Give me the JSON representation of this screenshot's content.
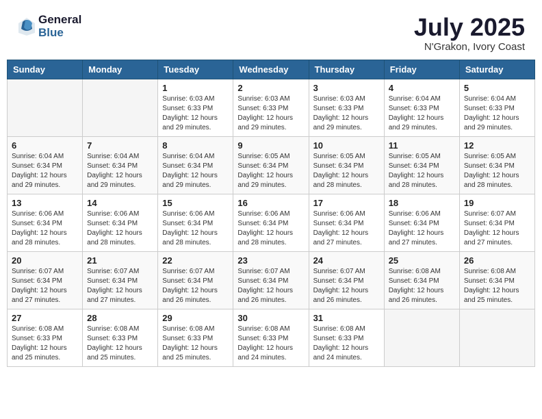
{
  "header": {
    "logo_general": "General",
    "logo_blue": "Blue",
    "month_year": "July 2025",
    "location": "N'Grakon, Ivory Coast"
  },
  "days_of_week": [
    "Sunday",
    "Monday",
    "Tuesday",
    "Wednesday",
    "Thursday",
    "Friday",
    "Saturday"
  ],
  "weeks": [
    [
      {
        "day": "",
        "sunrise": "",
        "sunset": "",
        "daylight": ""
      },
      {
        "day": "",
        "sunrise": "",
        "sunset": "",
        "daylight": ""
      },
      {
        "day": "1",
        "sunrise": "Sunrise: 6:03 AM",
        "sunset": "Sunset: 6:33 PM",
        "daylight": "Daylight: 12 hours and 29 minutes."
      },
      {
        "day": "2",
        "sunrise": "Sunrise: 6:03 AM",
        "sunset": "Sunset: 6:33 PM",
        "daylight": "Daylight: 12 hours and 29 minutes."
      },
      {
        "day": "3",
        "sunrise": "Sunrise: 6:03 AM",
        "sunset": "Sunset: 6:33 PM",
        "daylight": "Daylight: 12 hours and 29 minutes."
      },
      {
        "day": "4",
        "sunrise": "Sunrise: 6:04 AM",
        "sunset": "Sunset: 6:33 PM",
        "daylight": "Daylight: 12 hours and 29 minutes."
      },
      {
        "day": "5",
        "sunrise": "Sunrise: 6:04 AM",
        "sunset": "Sunset: 6:33 PM",
        "daylight": "Daylight: 12 hours and 29 minutes."
      }
    ],
    [
      {
        "day": "6",
        "sunrise": "Sunrise: 6:04 AM",
        "sunset": "Sunset: 6:34 PM",
        "daylight": "Daylight: 12 hours and 29 minutes."
      },
      {
        "day": "7",
        "sunrise": "Sunrise: 6:04 AM",
        "sunset": "Sunset: 6:34 PM",
        "daylight": "Daylight: 12 hours and 29 minutes."
      },
      {
        "day": "8",
        "sunrise": "Sunrise: 6:04 AM",
        "sunset": "Sunset: 6:34 PM",
        "daylight": "Daylight: 12 hours and 29 minutes."
      },
      {
        "day": "9",
        "sunrise": "Sunrise: 6:05 AM",
        "sunset": "Sunset: 6:34 PM",
        "daylight": "Daylight: 12 hours and 29 minutes."
      },
      {
        "day": "10",
        "sunrise": "Sunrise: 6:05 AM",
        "sunset": "Sunset: 6:34 PM",
        "daylight": "Daylight: 12 hours and 28 minutes."
      },
      {
        "day": "11",
        "sunrise": "Sunrise: 6:05 AM",
        "sunset": "Sunset: 6:34 PM",
        "daylight": "Daylight: 12 hours and 28 minutes."
      },
      {
        "day": "12",
        "sunrise": "Sunrise: 6:05 AM",
        "sunset": "Sunset: 6:34 PM",
        "daylight": "Daylight: 12 hours and 28 minutes."
      }
    ],
    [
      {
        "day": "13",
        "sunrise": "Sunrise: 6:06 AM",
        "sunset": "Sunset: 6:34 PM",
        "daylight": "Daylight: 12 hours and 28 minutes."
      },
      {
        "day": "14",
        "sunrise": "Sunrise: 6:06 AM",
        "sunset": "Sunset: 6:34 PM",
        "daylight": "Daylight: 12 hours and 28 minutes."
      },
      {
        "day": "15",
        "sunrise": "Sunrise: 6:06 AM",
        "sunset": "Sunset: 6:34 PM",
        "daylight": "Daylight: 12 hours and 28 minutes."
      },
      {
        "day": "16",
        "sunrise": "Sunrise: 6:06 AM",
        "sunset": "Sunset: 6:34 PM",
        "daylight": "Daylight: 12 hours and 28 minutes."
      },
      {
        "day": "17",
        "sunrise": "Sunrise: 6:06 AM",
        "sunset": "Sunset: 6:34 PM",
        "daylight": "Daylight: 12 hours and 27 minutes."
      },
      {
        "day": "18",
        "sunrise": "Sunrise: 6:06 AM",
        "sunset": "Sunset: 6:34 PM",
        "daylight": "Daylight: 12 hours and 27 minutes."
      },
      {
        "day": "19",
        "sunrise": "Sunrise: 6:07 AM",
        "sunset": "Sunset: 6:34 PM",
        "daylight": "Daylight: 12 hours and 27 minutes."
      }
    ],
    [
      {
        "day": "20",
        "sunrise": "Sunrise: 6:07 AM",
        "sunset": "Sunset: 6:34 PM",
        "daylight": "Daylight: 12 hours and 27 minutes."
      },
      {
        "day": "21",
        "sunrise": "Sunrise: 6:07 AM",
        "sunset": "Sunset: 6:34 PM",
        "daylight": "Daylight: 12 hours and 27 minutes."
      },
      {
        "day": "22",
        "sunrise": "Sunrise: 6:07 AM",
        "sunset": "Sunset: 6:34 PM",
        "daylight": "Daylight: 12 hours and 26 minutes."
      },
      {
        "day": "23",
        "sunrise": "Sunrise: 6:07 AM",
        "sunset": "Sunset: 6:34 PM",
        "daylight": "Daylight: 12 hours and 26 minutes."
      },
      {
        "day": "24",
        "sunrise": "Sunrise: 6:07 AM",
        "sunset": "Sunset: 6:34 PM",
        "daylight": "Daylight: 12 hours and 26 minutes."
      },
      {
        "day": "25",
        "sunrise": "Sunrise: 6:08 AM",
        "sunset": "Sunset: 6:34 PM",
        "daylight": "Daylight: 12 hours and 26 minutes."
      },
      {
        "day": "26",
        "sunrise": "Sunrise: 6:08 AM",
        "sunset": "Sunset: 6:34 PM",
        "daylight": "Daylight: 12 hours and 25 minutes."
      }
    ],
    [
      {
        "day": "27",
        "sunrise": "Sunrise: 6:08 AM",
        "sunset": "Sunset: 6:33 PM",
        "daylight": "Daylight: 12 hours and 25 minutes."
      },
      {
        "day": "28",
        "sunrise": "Sunrise: 6:08 AM",
        "sunset": "Sunset: 6:33 PM",
        "daylight": "Daylight: 12 hours and 25 minutes."
      },
      {
        "day": "29",
        "sunrise": "Sunrise: 6:08 AM",
        "sunset": "Sunset: 6:33 PM",
        "daylight": "Daylight: 12 hours and 25 minutes."
      },
      {
        "day": "30",
        "sunrise": "Sunrise: 6:08 AM",
        "sunset": "Sunset: 6:33 PM",
        "daylight": "Daylight: 12 hours and 24 minutes."
      },
      {
        "day": "31",
        "sunrise": "Sunrise: 6:08 AM",
        "sunset": "Sunset: 6:33 PM",
        "daylight": "Daylight: 12 hours and 24 minutes."
      },
      {
        "day": "",
        "sunrise": "",
        "sunset": "",
        "daylight": ""
      },
      {
        "day": "",
        "sunrise": "",
        "sunset": "",
        "daylight": ""
      }
    ]
  ]
}
